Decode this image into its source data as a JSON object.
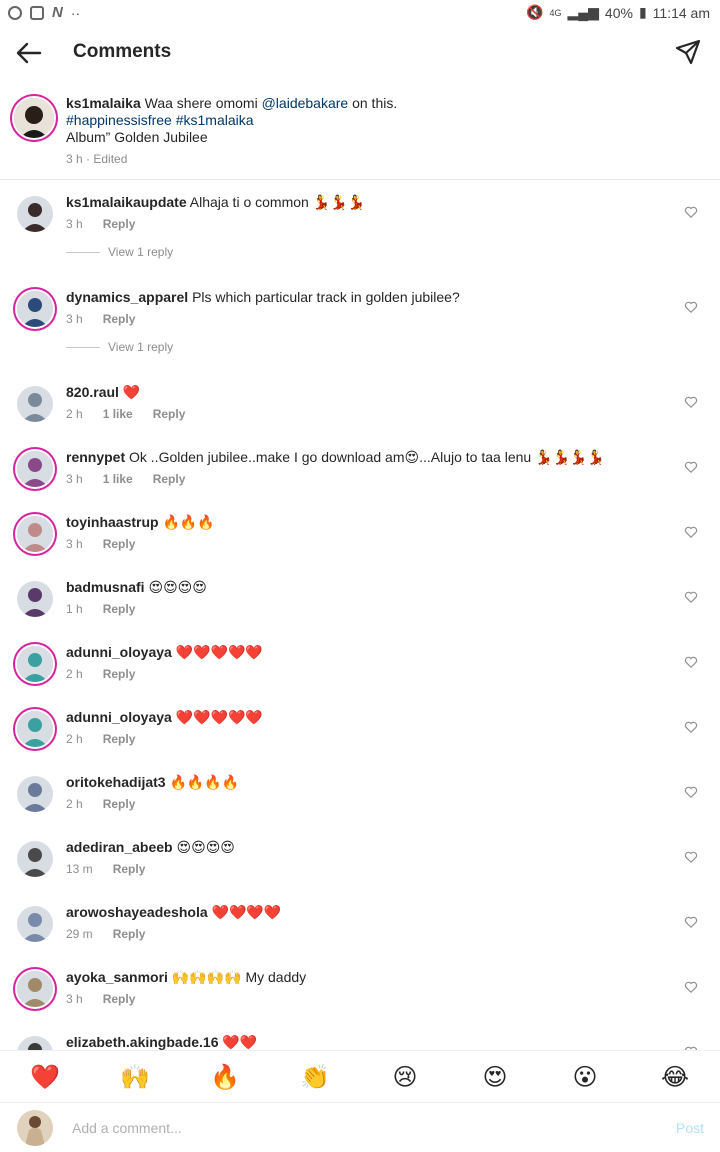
{
  "status_bar": {
    "battery": "40%",
    "time": "11:14 am",
    "network": "4G"
  },
  "header": {
    "title": "Comments"
  },
  "caption": {
    "username": "ks1malaika",
    "text_1": "Waa shere omomi ",
    "mention": "@laidebakare",
    "text_2": " on this.",
    "hashtags": "#happinessisfree #ks1malaika",
    "text_3": "Album” Golden Jubilee",
    "meta": "3 h · Edited"
  },
  "comments": [
    {
      "username": "ks1malaikaupdate",
      "text": "Alhaja ti o common 💃💃💃",
      "time": "3 h",
      "likes": "",
      "reply": "Reply",
      "view_replies": "View 1 reply",
      "ring": false,
      "avatar_color": "#3a2a2a"
    },
    {
      "username": "dynamics_apparel",
      "text": "Pls which particular track in golden jubilee?",
      "time": "3 h",
      "likes": "",
      "reply": "Reply",
      "view_replies": "View 1 reply",
      "ring": true,
      "avatar_color": "#2c4a7a"
    },
    {
      "username": "820.raul",
      "text": "❤️",
      "time": "2 h",
      "likes": "1 like",
      "reply": "Reply",
      "view_replies": "",
      "ring": false,
      "avatar_color": "#7a8a9a"
    },
    {
      "username": "rennypet",
      "text": "Ok ..Golden jubilee..make I go download am😍...Alujo to taa lenu 💃💃💃💃",
      "time": "3 h",
      "likes": "1 like",
      "reply": "Reply",
      "view_replies": "",
      "ring": true,
      "avatar_color": "#8a4a8a"
    },
    {
      "username": "toyinhaastrup",
      "text": "🔥🔥🔥",
      "time": "3 h",
      "likes": "",
      "reply": "Reply",
      "view_replies": "",
      "ring": true,
      "avatar_color": "#c08a8a"
    },
    {
      "username": "badmusnafi",
      "text": "😍😍😍😍",
      "time": "1 h",
      "likes": "",
      "reply": "Reply",
      "view_replies": "",
      "ring": false,
      "avatar_color": "#5a3a6a"
    },
    {
      "username": "adunni_oloyaya",
      "text": "❤️❤️❤️❤️❤️",
      "time": "2 h",
      "likes": "",
      "reply": "Reply",
      "view_replies": "",
      "ring": true,
      "avatar_color": "#3aa0a0"
    },
    {
      "username": "adunni_oloyaya",
      "text": "❤️❤️❤️❤️❤️",
      "time": "2 h",
      "likes": "",
      "reply": "Reply",
      "view_replies": "",
      "ring": true,
      "avatar_color": "#3aa0a0"
    },
    {
      "username": "oritokehadijat3",
      "text": "🔥🔥🔥🔥",
      "time": "2 h",
      "likes": "",
      "reply": "Reply",
      "view_replies": "",
      "ring": false,
      "avatar_color": "#6a7a9a"
    },
    {
      "username": "adediran_abeeb",
      "text": "😍😍😍😍",
      "time": "13 m",
      "likes": "",
      "reply": "Reply",
      "view_replies": "",
      "ring": false,
      "avatar_color": "#4a4a4a"
    },
    {
      "username": "arowoshayeadeshola",
      "text": "❤️❤️❤️❤️",
      "time": "29 m",
      "likes": "",
      "reply": "Reply",
      "view_replies": "",
      "ring": false,
      "avatar_color": "#7a8aaa"
    },
    {
      "username": "ayoka_sanmori",
      "text": "🙌🙌🙌🙌 My daddy",
      "time": "3 h",
      "likes": "",
      "reply": "Reply",
      "view_replies": "",
      "ring": true,
      "avatar_color": "#a08a6a"
    },
    {
      "username": "elizabeth.akingbade.16",
      "text": "❤️❤️",
      "time": "",
      "likes": "",
      "reply": "",
      "view_replies": "",
      "ring": false,
      "avatar_color": "#3a3a3a"
    }
  ],
  "emoji_bar": [
    "❤️",
    "🙌",
    "🔥",
    "👏",
    "😢",
    "😍",
    "😮",
    "😂"
  ],
  "input": {
    "placeholder": "Add a comment...",
    "value": "",
    "post_label": "Post"
  },
  "colors": {
    "accent_link": "#00376b",
    "post_disabled": "#b2dffc",
    "story_ring": "#d6249f",
    "muted": "#8e8e8e"
  }
}
